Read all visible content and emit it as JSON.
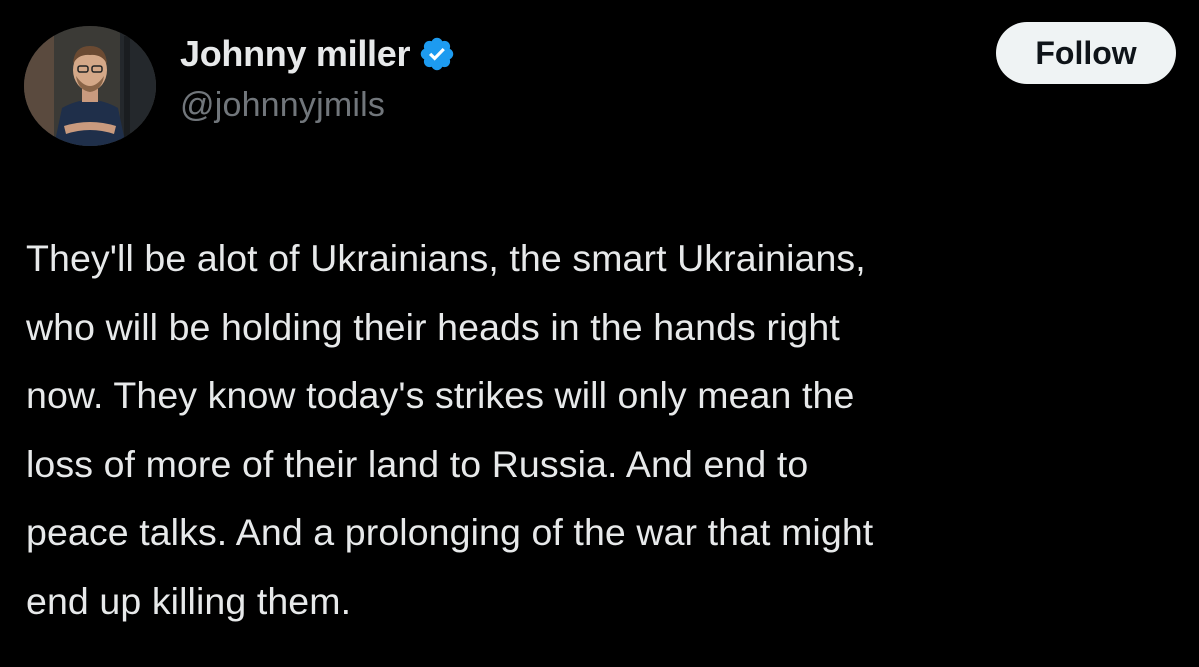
{
  "author": {
    "display_name": "Johnny miller",
    "handle": "@johnnyjmils",
    "verified": true,
    "avatar_icon": "profile-photo"
  },
  "actions": {
    "follow_label": "Follow"
  },
  "tweet": {
    "lines": [
      "They'll be alot of Ukrainians, the smart Ukrainians,",
      "who will be holding their heads in the hands right",
      "now. They know today's strikes will only mean the",
      "loss of more of their land to Russia. And end to",
      "peace talks. And a prolonging of the war that might",
      "end up killing them."
    ]
  },
  "colors": {
    "background": "#000000",
    "text_primary": "#e7e9ea",
    "text_secondary": "#71767b",
    "verified_blue": "#1d9bf0",
    "follow_bg": "#eff3f4",
    "follow_text": "#0f1419"
  }
}
